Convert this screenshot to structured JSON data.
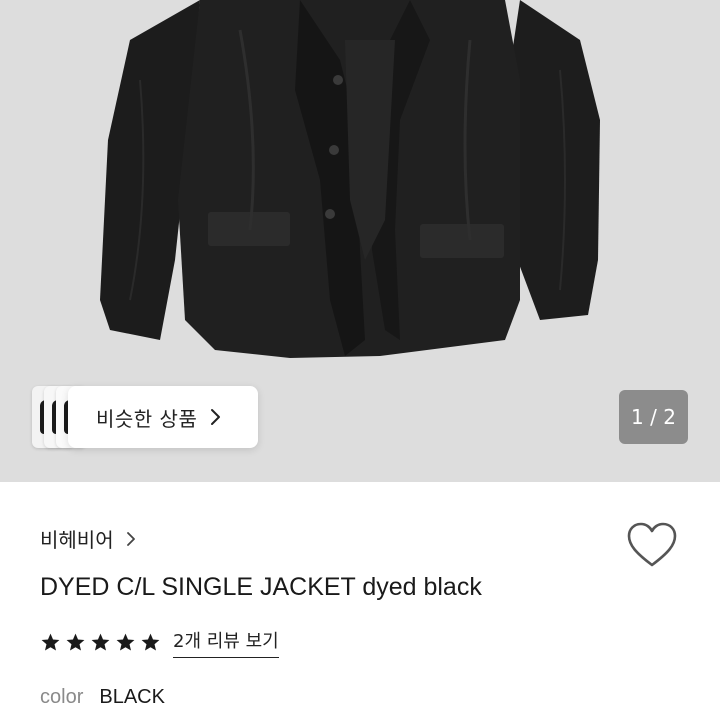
{
  "gallery": {
    "similar_label": "비슷한 상품",
    "page_indicator": "1 / 2",
    "background_color": "#dcdcdc"
  },
  "product": {
    "brand": "비헤비어",
    "title": "DYED C/L SINGLE JACKET dyed black",
    "rating_stars": 5,
    "review_link": "2개 리뷰 보기",
    "color_label": "color",
    "color_value": "BLACK"
  },
  "icons": {
    "chip_chevron": "chevron-right-icon",
    "brand_chevron": "chevron-right-icon",
    "wishlist": "heart-outline-icon",
    "star": "star-filled-icon"
  },
  "colors": {
    "accent_dark": "#1a1a1a",
    "indicator_bg": "#8c8c8c",
    "muted_text": "#8a8a8a"
  }
}
